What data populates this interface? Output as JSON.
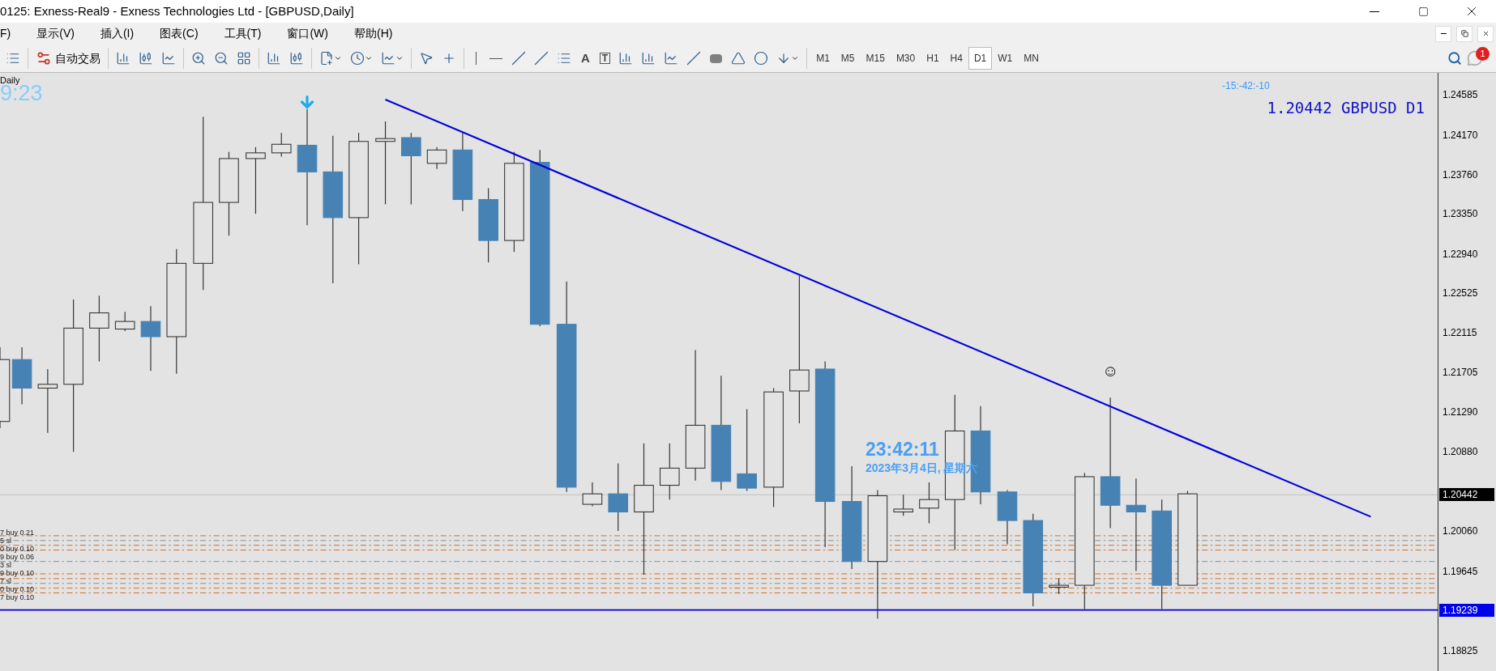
{
  "window": {
    "title": "0125: Exness-Real9 - Exness Technologies Ltd - [GBPUSD,Daily]"
  },
  "menu": [
    "F)",
    "显示(V)",
    "插入(I)",
    "图表(C)",
    "工具(T)",
    "窗口(W)",
    "帮助(H)"
  ],
  "toolbar": {
    "auto_trading": "自动交易",
    "text_tool": "A",
    "label_tool": "T",
    "timeframes": [
      {
        "label": "M1",
        "selected": false
      },
      {
        "label": "M5",
        "selected": false
      },
      {
        "label": "M15",
        "selected": false
      },
      {
        "label": "M30",
        "selected": false
      },
      {
        "label": "H1",
        "selected": false
      },
      {
        "label": "H4",
        "selected": false
      },
      {
        "label": "D1",
        "selected": true
      },
      {
        "label": "W1",
        "selected": false
      },
      {
        "label": "MN",
        "selected": false
      }
    ],
    "notifications": "1"
  },
  "chart": {
    "period": "Daily",
    "clock": "9:23",
    "countdown": "-15:-42:-10",
    "quote": "1.20442 GBPUSD D1",
    "time": "23:42:11",
    "date": "2023年3月4日, 星期六",
    "smiley": "☺",
    "order_labels": [
      "7 buy 0.21",
      "5 sl",
      "0 buy 0.10",
      "9 buy 0.06",
      "3 sl",
      "9 buy 0.10",
      "7 sl",
      "0 buy 0.10",
      "7 buy 0.10"
    ],
    "price_axis": [
      "1.24585",
      "1.24170",
      "1.23760",
      "1.23350",
      "1.22940",
      "1.22525",
      "1.22115",
      "1.21705",
      "1.21290",
      "1.20880",
      "1.20060",
      "1.19645",
      "1.18825"
    ],
    "current_price": "1.20442",
    "line_price": "1.19239"
  }
}
